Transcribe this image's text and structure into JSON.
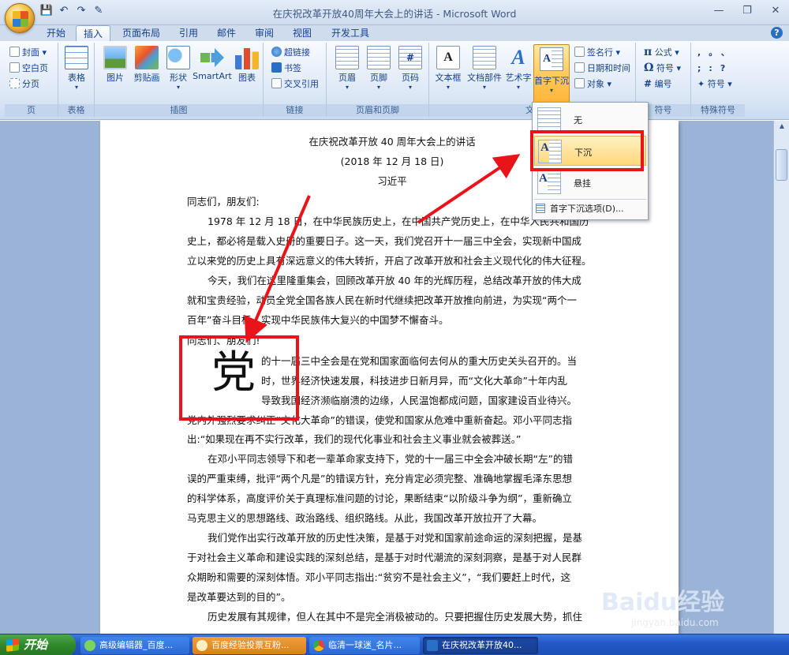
{
  "window": {
    "title": "在庆祝改革开放40周年大会上的讲话 - Microsoft Word",
    "quick_access": [
      "💾",
      "↶",
      "↷",
      "✎"
    ]
  },
  "tabs": [
    "开始",
    "插入",
    "页面布局",
    "引用",
    "邮件",
    "审阅",
    "视图",
    "开发工具"
  ],
  "active_tab": "插入",
  "ribbon": {
    "pages_group": {
      "label": "页",
      "items": [
        "封面",
        "空白页",
        "分页"
      ]
    },
    "table_group": {
      "label": "表格",
      "items": [
        "表格"
      ]
    },
    "illustrations_group": {
      "label": "插图",
      "items": [
        "图片",
        "剪贴画",
        "形状",
        "SmartArt",
        "图表"
      ]
    },
    "links_group": {
      "label": "链接",
      "items": [
        "超链接",
        "书签",
        "交叉引用"
      ]
    },
    "header_footer_group": {
      "label": "页眉和页脚",
      "items": [
        "页眉",
        "页脚",
        "页码"
      ]
    },
    "text_group": {
      "label": "文",
      "items": [
        "文本框",
        "文档部件",
        "艺术字",
        "首字下沉",
        "签名行",
        "日期和时间",
        "对象"
      ]
    },
    "symbols_group": {
      "label": "符号",
      "items": [
        "公式",
        "符号",
        "编号"
      ]
    },
    "special_group": {
      "label": "特殊符号",
      "symbols": [
        ",",
        "。",
        "、",
        ";",
        ":",
        "?"
      ],
      "more": "符号"
    }
  },
  "dropcap_menu": {
    "items": [
      "无",
      "下沉",
      "悬挂"
    ],
    "highlighted": "下沉",
    "options": "首字下沉选项(D)..."
  },
  "document": {
    "title": "在庆祝改革开放 40 周年大会上的讲话",
    "date": "(2018 年 12 月 18 日)",
    "author": "习近平",
    "lines": [
      "同志们，朋友们:",
      "1978 年 12 月 18 日，在中华民族历史上，在中国共产党历史上，在中华人民共和国历",
      "史上，都必将是载入史册的重要日子。这一天，我们党召开十一届三中全会，实现新中国成",
      "立以来党的历史上具有深远意义的伟大转折，开启了改革开放和社会主义现代化的伟大征程。",
      "今天，我们在这里隆重集会，回顾改革开放 40 年的光辉历程，总结改革开放的伟大成",
      "就和宝贵经验，动员全党全国各族人民在新时代继续把改革开放推向前进，为实现“两个一",
      "百年”奋斗目标、实现中华民族伟大复兴的中国梦不懈奋斗。",
      "同志们、朋友们!"
    ],
    "dropcap_char": "党",
    "dropcap_lines": [
      "的十一届三中全会是在党和国家面临何去何从的重大历史关头召开的。当",
      "时，世界经济快速发展，科技进步日新月异，而“文化大革命”十年内乱",
      "导致我国经济濒临崩溃的边缘，人民温饱都成问题，国家建设百业待兴。"
    ],
    "after_lines": [
      "党内外强烈要求纠正“文化大革命”的错误，使党和国家从危难中重新奋起。邓小平同志指",
      "出:“如果现在再不实行改革，我们的现代化事业和社会主义事业就会被葬送。”",
      "在邓小平同志领导下和老一辈革命家支持下，党的十一届三中全会冲破长期“左”的错",
      "误的严重束缚，批评“两个凡是”的错误方针，充分肯定必须完整、准确地掌握毛泽东思想",
      "的科学体系，高度评价关于真理标准问题的讨论，果断结束“以阶级斗争为纲”，重新确立",
      "马克思主义的思想路线、政治路线、组织路线。从此，我国改革开放拉开了大幕。",
      "我们党作出实行改革开放的历史性决策，是基于对党和国家前途命运的深刻把握，是基",
      "于对社会主义革命和建设实践的深刻总结，是基于对时代潮流的深刻洞察，是基于对人民群",
      "众期盼和需要的深刻体悟。邓小平同志指出:“贫穷不是社会主义”，“我们要赶上时代，这",
      "是改革要达到的目的”。",
      "历史发展有其规律，但人在其中不是完全消极被动的。只要把握住历史发展大势，抓住"
    ]
  },
  "taskbar": {
    "start": "开始",
    "tasks": [
      "高级编辑器_百度...",
      "百度经验投票互粉...",
      "临清一球迷_名片...",
      "在庆祝改革开放40..."
    ]
  },
  "watermark": {
    "main": "Baidu经验",
    "sub": "jingyan.baidu.com"
  },
  "colors": {
    "annotation": "#e8141a",
    "ribbon_bg": "#dce7f5",
    "highlight": "#ffd87a"
  }
}
